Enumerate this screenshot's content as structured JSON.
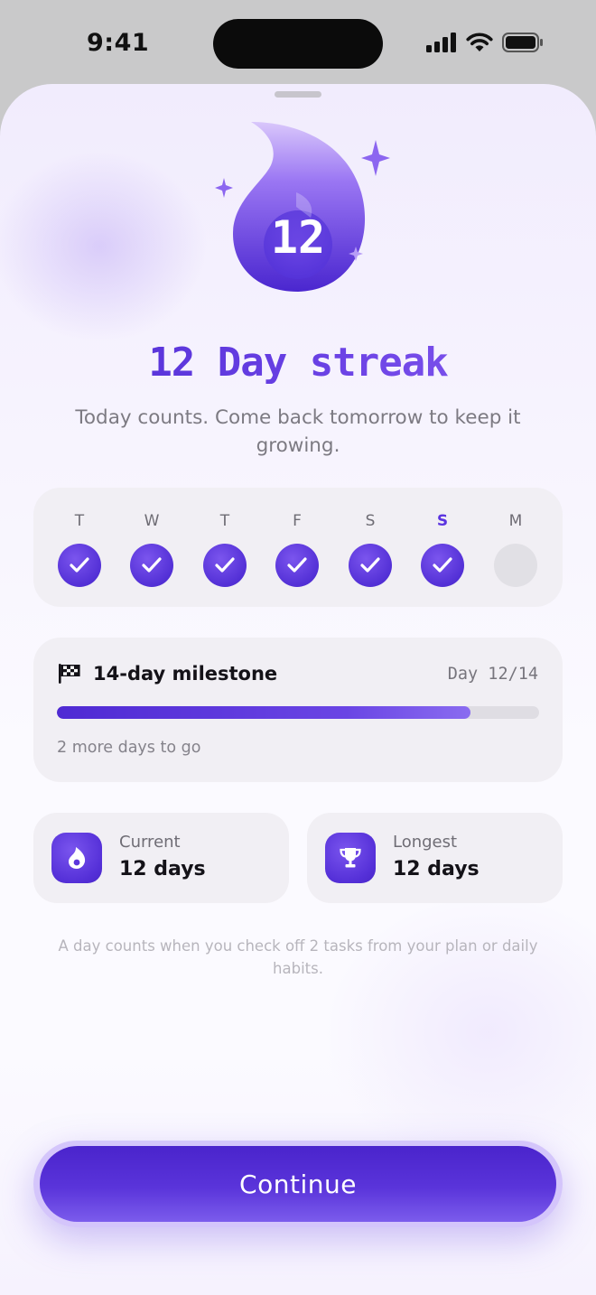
{
  "status_bar": {
    "time": "9:41"
  },
  "streak": {
    "badge_number": "12",
    "title": "12 Day streak",
    "subtitle": "Today counts. Come back tomorrow to keep it growing."
  },
  "week": {
    "days": [
      {
        "letter": "T",
        "done": true,
        "today": false
      },
      {
        "letter": "W",
        "done": true,
        "today": false
      },
      {
        "letter": "T",
        "done": true,
        "today": false
      },
      {
        "letter": "F",
        "done": true,
        "today": false
      },
      {
        "letter": "S",
        "done": true,
        "today": false
      },
      {
        "letter": "S",
        "done": true,
        "today": true
      },
      {
        "letter": "M",
        "done": false,
        "today": false
      }
    ]
  },
  "milestone": {
    "label": "14-day milestone",
    "count": "Day 12/14",
    "progress": 0.857,
    "remaining": "2 more days to go"
  },
  "stats": {
    "current": {
      "label": "Current",
      "value": "12 days",
      "icon": "flame-icon"
    },
    "longest": {
      "label": "Longest",
      "value": "12 days",
      "icon": "trophy-icon"
    }
  },
  "footnote": "A day counts when you check off 2 tasks from your plan or daily habits.",
  "cta": {
    "label": "Continue"
  },
  "colors": {
    "accent": "#5b34e0",
    "card_bg": "#f1eff4",
    "empty_day": "#e1e0e5"
  }
}
